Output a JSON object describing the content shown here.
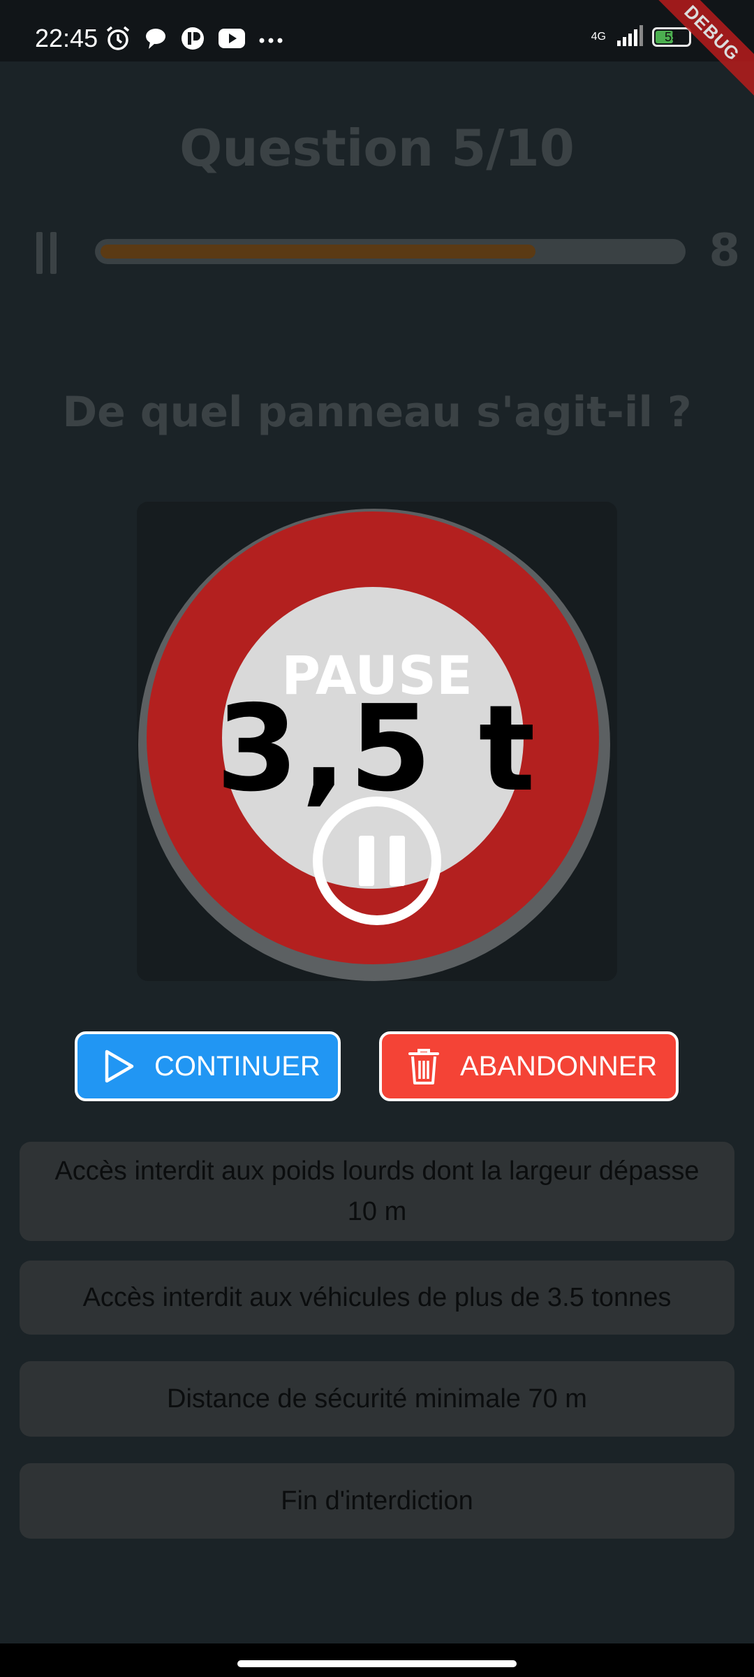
{
  "status_bar": {
    "time": "22:45",
    "network": "4G",
    "battery": "55",
    "battery_level": 0.55,
    "icons_left": [
      "alarm-icon",
      "chat-icon",
      "app-icon",
      "youtube-icon",
      "more-icon"
    ]
  },
  "debug_banner": "DEBUG",
  "header": {
    "title": "Question 5/10",
    "timer": "8",
    "progress": 0.75
  },
  "question": "De quel panneau s'agit-il ?",
  "sign": {
    "text": "3,5 t"
  },
  "pause_overlay": {
    "label": "PAUSE",
    "continue_label": "CONTINUER",
    "abandon_label": "ABANDONNER"
  },
  "answers": [
    "Accès interdit aux poids lourds dont la largeur dépasse 10 m",
    "Accès interdit aux véhicules de plus de 3.5 tonnes",
    "Distance de sécurité minimale 70 m",
    "Fin d'interdiction"
  ],
  "colors": {
    "continue": "#2196f3",
    "abandon": "#f44336",
    "progress": "#5b3a14",
    "sign_red": "#b3201f"
  }
}
